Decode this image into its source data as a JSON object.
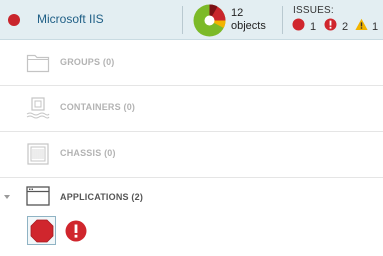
{
  "header": {
    "title": "Microsoft IIS",
    "objects_count": "12",
    "objects_label": "objects",
    "issues_label": "ISSUES:",
    "issues": [
      {
        "icon": "critical-icon",
        "count": "1",
        "color": "#d0262d"
      },
      {
        "icon": "error-icon",
        "count": "2",
        "color": "#d0262d"
      },
      {
        "icon": "warning-icon",
        "count": "1",
        "color": "#f2b400"
      }
    ],
    "donut_segments": [
      {
        "name": "critical",
        "fraction": 0.25,
        "color": "#c9252c"
      },
      {
        "name": "warning",
        "fraction": 0.08,
        "color": "#f2b400"
      },
      {
        "name": "ok",
        "fraction": 0.67,
        "color": "#7cba28"
      }
    ]
  },
  "groups": [
    {
      "label": "GROUPS (0)",
      "icon": "folder-icon"
    },
    {
      "label": "CONTAINERS (0)",
      "icon": "container-icon"
    },
    {
      "label": "CHASSIS (0)",
      "icon": "chassis-icon"
    },
    {
      "label": "APPLICATIONS (2)",
      "icon": "application-window-icon"
    }
  ],
  "applications": [
    {
      "icon": "stop-octagon-icon",
      "status": "critical"
    },
    {
      "icon": "error-circle-icon",
      "status": "error"
    }
  ]
}
